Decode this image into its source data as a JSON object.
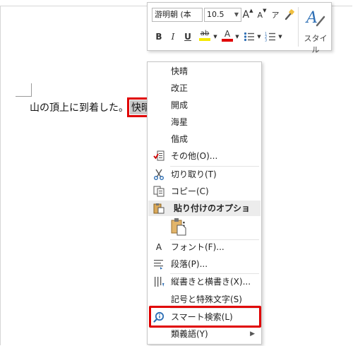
{
  "document": {
    "text_before": "山の頂上に到着した。",
    "selected_word": "快晴"
  },
  "mini_toolbar": {
    "font_name": "游明朝 (本",
    "font_size": "10.5",
    "grow_font": "A",
    "shrink_font": "A",
    "phonetic": "ア",
    "bold": "B",
    "italic": "I",
    "underline": "U",
    "highlight": "ab",
    "font_color": "A",
    "styles_label": "スタイル",
    "highlight_color": "#f5e800",
    "font_color_color": "#e00000",
    "style_icon_color": "#2e6fb5"
  },
  "context_menu": {
    "suggestions": [
      "快晴",
      "改正",
      "開成",
      "海星",
      "偕成"
    ],
    "other": "その他(O)...",
    "cut": "切り取り(T)",
    "copy": "コピー(C)",
    "paste_options": "貼り付けのオプション:",
    "font": "フォント(F)...",
    "paragraph": "段落(P)...",
    "text_direction": "縦書きと横書き(X)...",
    "symbols": "記号と特殊文字(S)",
    "smart_lookup": "スマート検索(L)",
    "synonyms": "類義語(Y)"
  },
  "highlight_color": "#e00000"
}
